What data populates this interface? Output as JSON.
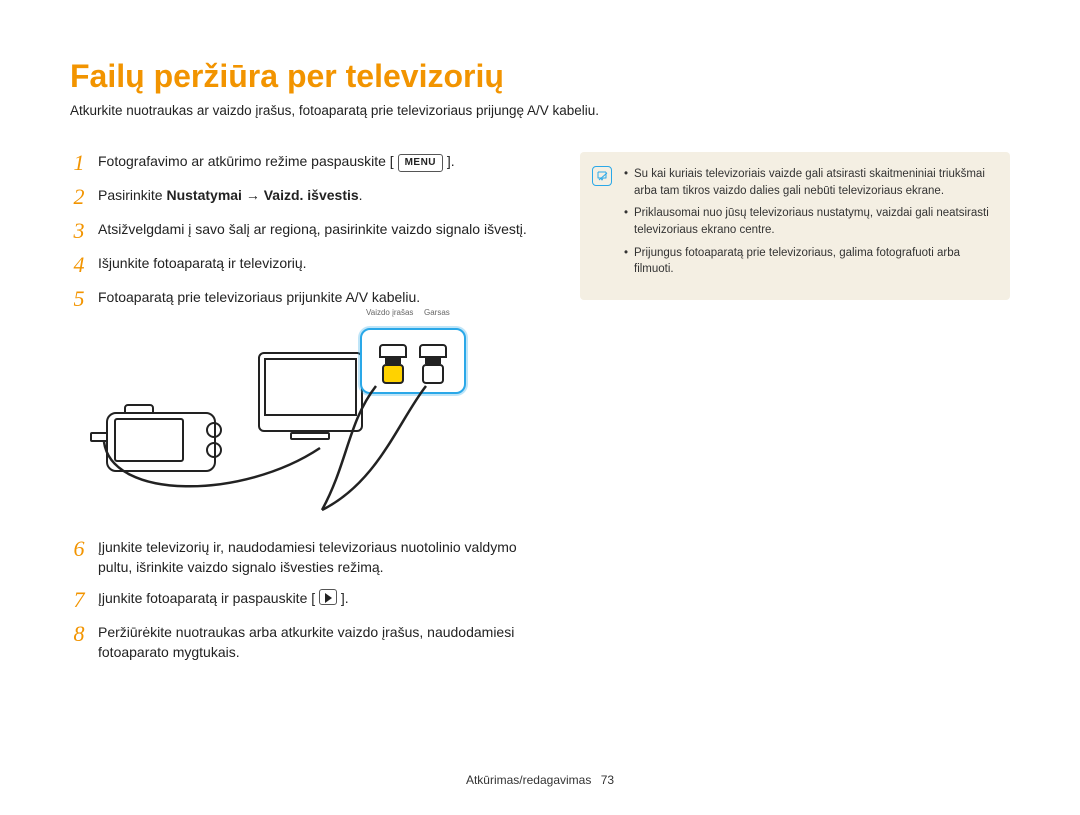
{
  "title": "Failų peržiūra per televizorių",
  "subtitle": "Atkurkite nuotraukas ar vaizdo įrašus, fotoaparatą prie televizoriaus prijungę A/V kabeliu.",
  "steps": {
    "s1a": "Fotografavimo ar atkūrimo režime paspauskite [ ",
    "s1btn": "MENU",
    "s1b": " ].",
    "s2a": "Pasirinkite ",
    "s2bold": "Nustatymai → Vaizd. išvestis",
    "s2b": ".",
    "s3": "Atsižvelgdami į savo šalį ar regioną, pasirinkite vaizdo signalo išvestį.",
    "s4": "Išjunkite fotoaparatą ir televizorių.",
    "s5": "Fotoaparatą prie televizoriaus prijunkite A/V kabeliu.",
    "s6": "Įjunkite televizorių ir, naudodamiesi televizoriaus nuotolinio valdymo pultu, išrinkite vaizdo signalo išvesties režimą.",
    "s7a": "Įjunkite fotoaparatą ir paspauskite [ ",
    "s7b": " ].",
    "s8": "Peržiūrėkite nuotraukas arba atkurkite vaizdo įrašus, naudodamiesi fotoaparato mygtukais."
  },
  "diagram": {
    "video_label": "Vaizdo įrašas",
    "audio_label": "Garsas"
  },
  "notes": {
    "n1": "Su kai kuriais televizoriais vaizde gali atsirasti skaitmeniniai triukšmai arba tam tikros vaizdo dalies gali nebūti televizoriaus ekrane.",
    "n2": "Priklausomai nuo jūsų televizoriaus nustatymų, vaizdai gali neatsirasti televizoriaus ekrano centre.",
    "n3": "Prijungus fotoaparatą prie televizoriaus, galima fotografuoti arba filmuoti."
  },
  "footer": {
    "section": "Atkūrimas/redagavimas",
    "page": "73"
  },
  "nums": {
    "1": "1",
    "2": "2",
    "3": "3",
    "4": "4",
    "5": "5",
    "6": "6",
    "7": "7",
    "8": "8"
  }
}
